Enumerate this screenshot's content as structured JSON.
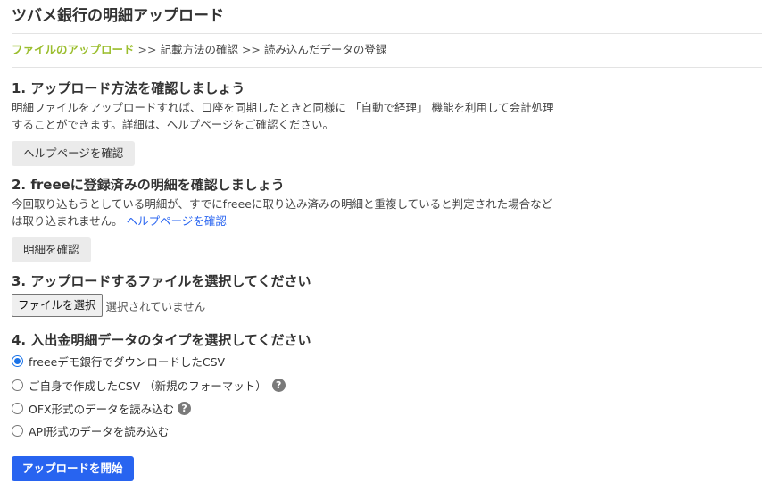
{
  "page": {
    "title": "ツバメ銀行の明細アップロード"
  },
  "breadcrumb": {
    "current": "ファイルのアップロード",
    "separator": ">>",
    "step2": "記載方法の確認",
    "step3": "読み込んだデータの登録"
  },
  "section1": {
    "heading": "1. アップロード方法を確認しましょう",
    "desc_line1": "明細ファイルをアップロードすれば、口座を同期したときと同様に 「自動で経理」 機能を利用して会計処理",
    "desc_line2": "することができます。詳細は、ヘルプページをご確認ください。",
    "button_label": "ヘルプページを確認"
  },
  "section2": {
    "heading": "2. freeeに登録済みの明細を確認しましょう",
    "desc_line1": "今回取り込もうとしている明細が、すでにfreeeに取り込み済みの明細と重複していると判定された場合など",
    "desc_line2": "は取り込まれません。",
    "help_link": "ヘルプページを確認",
    "button_label": "明細を確認"
  },
  "section3": {
    "heading": "3. アップロードするファイルを選択してください",
    "file_button": "ファイルを選択",
    "file_status": "選択されていません"
  },
  "section4": {
    "heading": "4. 入出金明細データのタイプを選択してください",
    "options": [
      {
        "label": "freeeデモ銀行でダウンロードしたCSV",
        "checked": true
      },
      {
        "label": "ご自身で作成したCSV （新規のフォーマット）",
        "checked": false
      },
      {
        "label": "OFX形式のデータを読み込む",
        "checked": false
      },
      {
        "label": "API形式のデータを読み込む",
        "checked": false
      }
    ]
  },
  "submit": {
    "label": "アップロードを開始"
  },
  "colors": {
    "accent_green": "#9bbe2e",
    "link_blue": "#2864f0",
    "primary": "#2864f0"
  },
  "icons": {
    "help": "question-circle-icon"
  }
}
